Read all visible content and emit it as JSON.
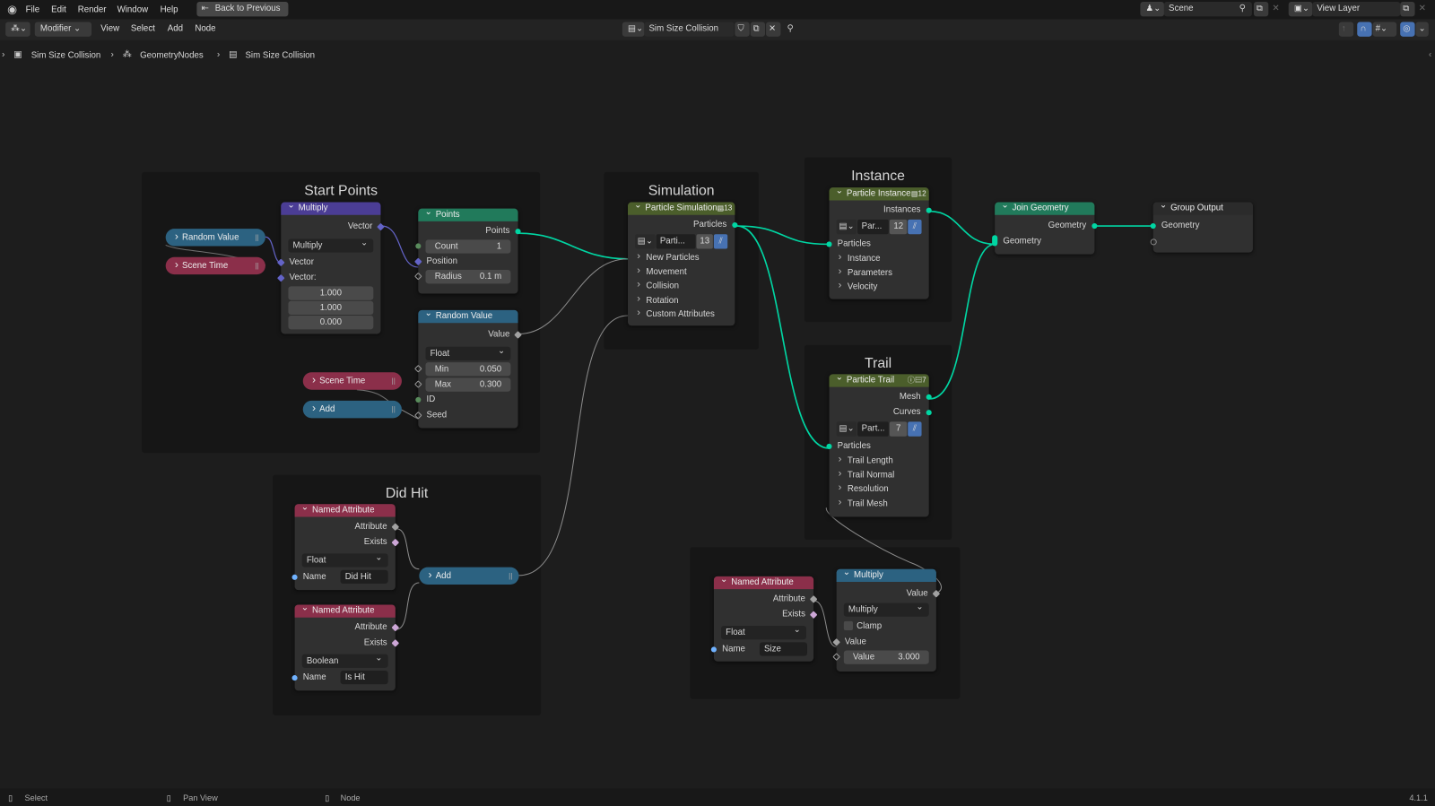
{
  "menubar": {
    "items": [
      "File",
      "Edit",
      "Render",
      "Window",
      "Help"
    ],
    "back_button": "Back to Previous",
    "scene": "Scene",
    "view_layer": "View Layer"
  },
  "header": {
    "editor_mode": "Modifier",
    "menus": [
      "View",
      "Select",
      "Add",
      "Node"
    ],
    "node_tree": "Sim Size Collision"
  },
  "breadcrumb": [
    "Sim Size Collision",
    "GeometryNodes",
    "Sim Size Collision"
  ],
  "frames": {
    "start_points": "Start Points",
    "simulation": "Simulation",
    "instance": "Instance",
    "trail": "Trail",
    "did_hit": "Did Hit"
  },
  "nodes": {
    "random_value_pill": "Random Value",
    "scene_time_pill": "Scene Time",
    "scene_time_pill2": "Scene Time",
    "add_pill": "Add",
    "add_pill2": "Add",
    "multiply_vec": {
      "title": "Multiply",
      "out": "Vector",
      "op": "Multiply",
      "in1": "Vector",
      "in2": "Vector:",
      "vals": [
        "1.000",
        "1.000",
        "0.000"
      ]
    },
    "points": {
      "title": "Points",
      "out": "Points",
      "count_label": "Count",
      "count": "1",
      "position": "Position",
      "radius_label": "Radius",
      "radius": "0.1 m"
    },
    "random_value": {
      "title": "Random Value",
      "out": "Value",
      "type": "Float",
      "min_label": "Min",
      "min": "0.050",
      "max_label": "Max",
      "max": "0.300",
      "id": "ID",
      "seed": "Seed"
    },
    "particle_sim": {
      "title": "Particle Simulation...",
      "badge": "13",
      "out": "Particles",
      "bundle_name": "Parti...",
      "bundle_num": "13",
      "panels": [
        "New Particles",
        "Movement",
        "Collision",
        "Rotation",
        "Custom Attributes"
      ]
    },
    "particle_instance": {
      "title": "Particle Instance",
      "badge": "12",
      "out": "Instances",
      "bundle_name": "Par...",
      "bundle_num": "12",
      "in": "Particles",
      "panels": [
        "Instance",
        "Parameters",
        "Velocity"
      ]
    },
    "particle_trail": {
      "title": "Particle Trail",
      "badge": "7",
      "out1": "Mesh",
      "out2": "Curves",
      "bundle_name": "Part...",
      "bundle_num": "7",
      "in": "Particles",
      "panels": [
        "Trail Length",
        "Trail Normal",
        "Resolution",
        "Trail Mesh"
      ]
    },
    "join_geometry": {
      "title": "Join Geometry",
      "out": "Geometry",
      "in": "Geometry"
    },
    "group_output": {
      "title": "Group Output",
      "in": "Geometry"
    },
    "named_attr1": {
      "title": "Named Attribute",
      "out1": "Attribute",
      "out2": "Exists",
      "type": "Float",
      "name_label": "Name",
      "name": "Did Hit"
    },
    "named_attr2": {
      "title": "Named Attribute",
      "out1": "Attribute",
      "out2": "Exists",
      "type": "Boolean",
      "name_label": "Name",
      "name": "Is Hit"
    },
    "named_attr3": {
      "title": "Named Attribute",
      "out1": "Attribute",
      "out2": "Exists",
      "type": "Float",
      "name_label": "Name",
      "name": "Size"
    },
    "multiply_math": {
      "title": "Multiply",
      "out": "Value",
      "op": "Multiply",
      "clamp": "Clamp",
      "in1": "Value",
      "in2_label": "Value",
      "in2": "3.000"
    }
  },
  "statusbar": {
    "select": "Select",
    "pan": "Pan View",
    "node": "Node",
    "version": "4.1.1"
  },
  "colors": {
    "geometry_wire": "#00d6a3",
    "vector_header": "#4b3d95",
    "geometry_header": "#217a5b",
    "utility_header": "#2c6281",
    "input_header": "#8b2f4a",
    "simulation_header": "#4b5e2b"
  }
}
